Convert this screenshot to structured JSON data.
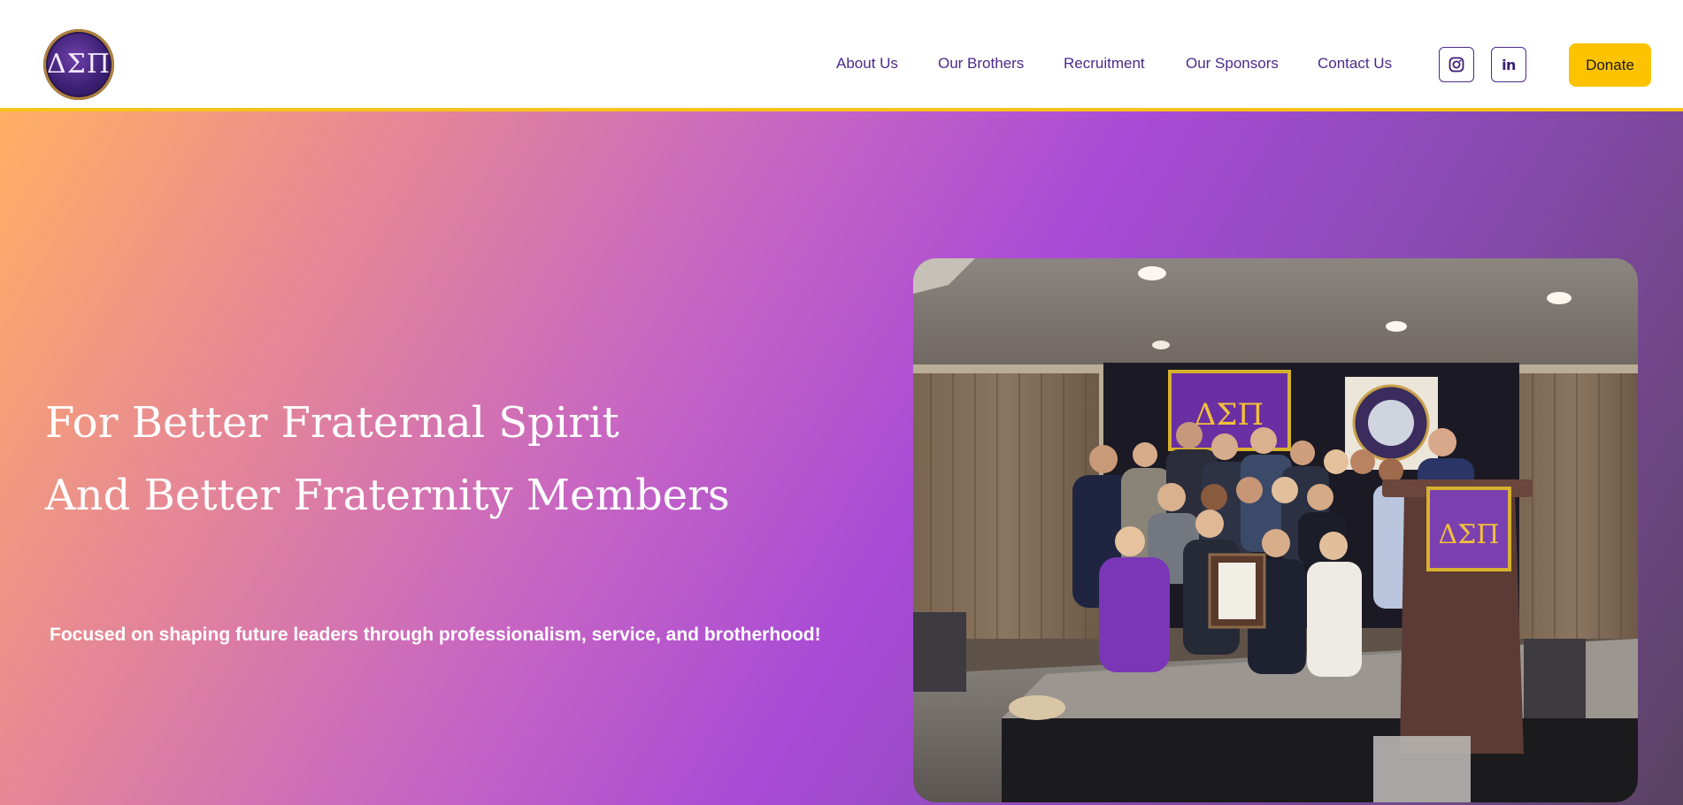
{
  "header": {
    "logo_text": "ΔΣΠ",
    "nav": [
      {
        "label": "About Us"
      },
      {
        "label": "Our Brothers"
      },
      {
        "label": "Recruitment"
      },
      {
        "label": "Our Sponsors"
      },
      {
        "label": "Contact Us"
      }
    ],
    "social": {
      "instagram_icon": "instagram-icon",
      "linkedin_label": "in"
    },
    "donate_label": "Donate"
  },
  "hero": {
    "title_line1": "For Better Fraternal Spirit",
    "title_line2": "And Better Fraternity Members",
    "subtitle": "Focused on shaping future leaders through professionalism, service, and brotherhood!",
    "banner_text": "ΔΣΠ",
    "podium_text": "ΔΣΠ"
  },
  "colors": {
    "accent_yellow": "#fdc300",
    "brand_purple": "#4b2a8a",
    "header_border": "#f7c21b"
  }
}
